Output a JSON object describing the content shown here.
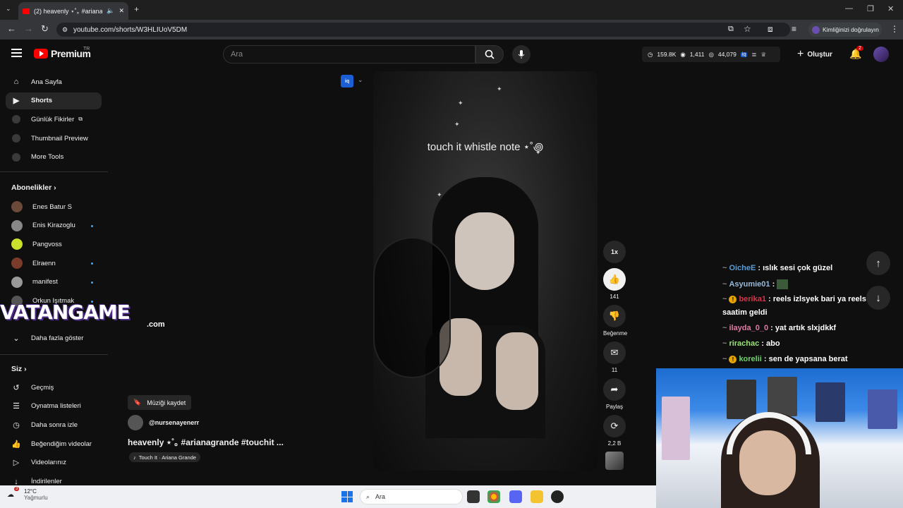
{
  "browser": {
    "tab_title": "(2) heavenly ⋆˚｡ #arianagra",
    "url": "youtube.com/shorts/W3HLIUoV5DM",
    "profile_label": "Kimliğinizi doğrulayın"
  },
  "header": {
    "logo_text": "Premium",
    "logo_region": "TR",
    "search_placeholder": "Ara",
    "stats": {
      "views": "159.8K",
      "likes": "1,411",
      "watchers": "44,079"
    },
    "create_label": "Oluştur",
    "notif_count": "2"
  },
  "sidebar": {
    "main": [
      {
        "label": "Ana Sayfa",
        "icon": "home-icon"
      },
      {
        "label": "Shorts",
        "icon": "shorts-icon",
        "active": true
      },
      {
        "label": "Günlük Fikirler",
        "icon": "iq-icon",
        "external": true
      },
      {
        "label": "Thumbnail Preview",
        "icon": "iq-icon"
      },
      {
        "label": "More Tools",
        "icon": "iq-icon"
      }
    ],
    "subs_title": "Abonelikler",
    "subscriptions": [
      {
        "label": "Enes Batur S",
        "dot": false,
        "color": "#6b4a3a"
      },
      {
        "label": "Enis Kirazoglu",
        "dot": true,
        "color": "#888888"
      },
      {
        "label": "Pangvoss",
        "dot": false,
        "color": "#c9e02c"
      },
      {
        "label": "Elraenn",
        "dot": true,
        "color": "#7a3b2a"
      },
      {
        "label": "manifest",
        "dot": true,
        "color": "#999999"
      },
      {
        "label": "Orkun Işıtmak",
        "dot": true,
        "color": "#555555"
      }
    ],
    "show_more": "Daha fazla göster",
    "you_title": "Siz",
    "you_items": [
      {
        "label": "Geçmiş",
        "icon": "history-icon"
      },
      {
        "label": "Oynatma listeleri",
        "icon": "playlist-icon"
      },
      {
        "label": "Daha sonra izle",
        "icon": "clock-icon"
      },
      {
        "label": "Beğendiğim videolar",
        "icon": "thumbs-up-icon"
      },
      {
        "label": "Videolarınız",
        "icon": "video-icon"
      },
      {
        "label": "İndirilenler",
        "icon": "download-icon"
      }
    ]
  },
  "watermark": {
    "brand": "VATANGAME",
    "domain": ".com"
  },
  "video": {
    "caption": "touch it whistle note ⋆˚꩜",
    "save_music": "Müziği kaydet",
    "channel": "@nursenayenerr",
    "title": "heavenly ⋆˚｡ #arianagrande #touchit ...",
    "sound": "Touch It · Ariana Grande"
  },
  "actions": {
    "speed": "1x",
    "likes": "141",
    "dislike_label": "Beğenme",
    "comments": "11",
    "share_label": "Paylaş",
    "remix_count": "2,2 B"
  },
  "chat": [
    {
      "user": "OicheE",
      "color": "#5b9bd5",
      "msg": "ıslık sesi çok güzel",
      "alert": false
    },
    {
      "user": "Asyumie01",
      "color": "#9ab8d8",
      "msg": "",
      "alert": false
    },
    {
      "user": "berika1",
      "color": "#d8344a",
      "msg": "reels izlsyek bari ya reels",
      "alert": true
    },
    {
      "user": "",
      "color": "#ffffff",
      "msg": "saatim geldi",
      "alert": false
    },
    {
      "user": "ilayda_0_0",
      "color": "#e07aa5",
      "msg": "yat artık slxjdkkf",
      "alert": false
    },
    {
      "user": "rirachac",
      "color": "#9be37a",
      "msg": "abo",
      "alert": false
    },
    {
      "user": "korelii",
      "color": "#6cd36c",
      "msg": "sen de yapsana berat",
      "alert": true
    }
  ],
  "taskbar": {
    "temp": "12°C",
    "condition": "Yağmurlu",
    "weather_badge": "3",
    "search_label": "Ara"
  }
}
